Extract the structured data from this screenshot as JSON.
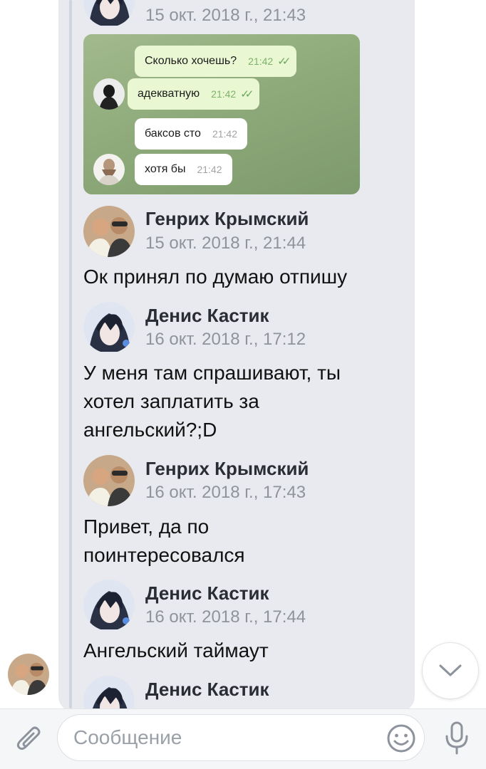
{
  "messages": [
    {
      "author": "",
      "date": "15 окт. 2018 г., 21:43",
      "text": ""
    },
    {
      "author": "Генрих Крымский",
      "date": "15 окт. 2018 г., 21:44",
      "text": "Ок принял по думаю отпишу"
    },
    {
      "author": "Денис Кастик",
      "date": "16 окт. 2018 г., 17:12",
      "lines": [
        "У меня там спрашивают, ты",
        "хотел заплатить за",
        "ангельский?;D"
      ]
    },
    {
      "author": "Генрих Крымский",
      "date": "16 окт. 2018 г., 17:43",
      "lines": [
        "Привет, да по",
        "поинтересовался"
      ]
    },
    {
      "author": "Денис Кастик",
      "date": "16 окт. 2018 г., 17:44",
      "text": "Ангельский таймаут"
    },
    {
      "author": "Денис Кастик",
      "date": ""
    }
  ],
  "screenshot": {
    "bubbles": [
      {
        "text": "Сколько хочешь?",
        "time": "21:42",
        "checks": "✓✓"
      },
      {
        "text": "адекватную",
        "time": "21:42",
        "checks": "✓✓"
      },
      {
        "text": "баксов сто",
        "time": "21:42"
      },
      {
        "text": "хотя бы",
        "time": "21:42"
      }
    ]
  },
  "composer": {
    "placeholder": "Сообщение",
    "value": ""
  },
  "icons": {
    "attach": "paperclip-icon",
    "emoji": "emoji-icon",
    "mic": "microphone-icon",
    "scroll_down": "chevron-down-icon"
  },
  "colors": {
    "bubble_bg": "#e9eaef",
    "name": "#2a2d33",
    "date": "#8e939c",
    "screenshot_bg": "#8fab7b",
    "outgoing_bubble": "#eaf7d3",
    "check": "#6aa75a"
  }
}
